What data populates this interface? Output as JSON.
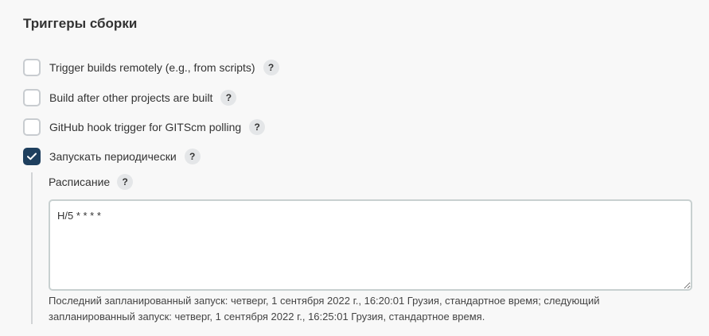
{
  "section": {
    "title": "Триггеры сборки"
  },
  "triggers": [
    {
      "label": "Trigger builds remotely (e.g., from scripts)",
      "checked": false
    },
    {
      "label": "Build after other projects are built",
      "checked": false
    },
    {
      "label": "GitHub hook trigger for GITScm polling",
      "checked": false
    },
    {
      "label": "Запускать периодически",
      "checked": true
    }
  ],
  "help_glyph": "?",
  "schedule": {
    "label": "Расписание",
    "value": "H/5 * * * *",
    "hint": "Последний запланированный запуск: четверг, 1 сентября 2022 г., 16:20:01 Грузия, стандартное время; следующий запланированный запуск: четверг, 1 сентября 2022 г., 16:25:01 Грузия, стандартное время."
  },
  "colors": {
    "checkbox_checked": "#1e3f5e",
    "checkbox_border": "#c8ccd0",
    "help_bg": "#e4e6e8",
    "page_bg": "#f8f8f8"
  },
  "icons": {
    "checkmark": "checkmark-icon",
    "help": "question-mark-icon"
  }
}
